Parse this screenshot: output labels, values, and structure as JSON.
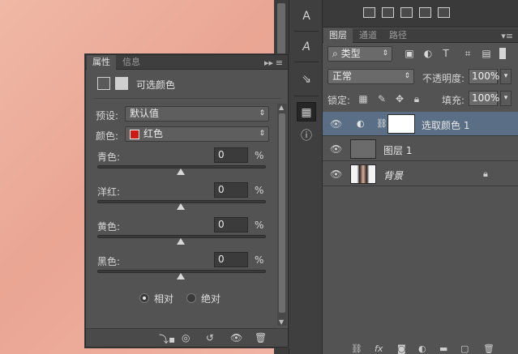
{
  "layers_panel": {
    "tabs": [
      "图层",
      "通道",
      "路径"
    ],
    "active_tab": 0,
    "menu_icon": "panel-menu-icon",
    "filter": {
      "label": "类型"
    },
    "filter_icons": [
      "image-filter-icon",
      "adjustment-filter-icon",
      "type-filter-icon",
      "shape-filter-icon",
      "smartobject-filter-icon"
    ],
    "blend_mode": "正常",
    "opacity_label": "不透明度:",
    "opacity_value": "100%",
    "lock_label": "锁定:",
    "fill_label": "填充:",
    "fill_value": "100%",
    "layers": [
      {
        "name": "选取颜色 1",
        "selected": true,
        "type": "adjustment"
      },
      {
        "name": "图层 1",
        "selected": false,
        "type": "pixel"
      },
      {
        "name": "背景",
        "selected": false,
        "type": "background",
        "locked": true
      }
    ],
    "footer_icons": [
      "link-icon",
      "fx-icon",
      "mask-icon",
      "adjustment-icon",
      "group-icon",
      "new-layer-icon",
      "delete-icon"
    ]
  },
  "properties_panel": {
    "tabs": [
      "属性",
      "信息"
    ],
    "active_tab": 0,
    "title": "可选颜色",
    "preset_label": "预设:",
    "preset_value": "默认值",
    "colors_label": "颜色:",
    "colors_value": "红色",
    "colors_swatch": "#d01b14",
    "sliders": [
      {
        "label": "青色:",
        "value": "0",
        "unit": "%",
        "position": 0.5
      },
      {
        "label": "洋红:",
        "value": "0",
        "unit": "%",
        "position": 0.5
      },
      {
        "label": "黄色:",
        "value": "0",
        "unit": "%",
        "position": 0.5
      },
      {
        "label": "黑色:",
        "value": "0",
        "unit": "%",
        "position": 0.5
      }
    ],
    "method": {
      "relative": "相对",
      "absolute": "绝对",
      "selected": "relative"
    },
    "footer_icons": [
      "clip-to-layer-icon",
      "view-previous-icon",
      "reset-icon",
      "visibility-icon",
      "delete-icon"
    ]
  },
  "toolstrip": {
    "tools": [
      "character-icon",
      "paragraph-icon",
      "glyph-icon",
      "properties-icon",
      "info-icon"
    ],
    "active": 3
  },
  "colors": {
    "panel": "#535353",
    "dark": "#3a3a3a",
    "selected_layer": "#5a6f86",
    "canvas": "#eeb1a1",
    "red_swatch": "#d01b14"
  }
}
